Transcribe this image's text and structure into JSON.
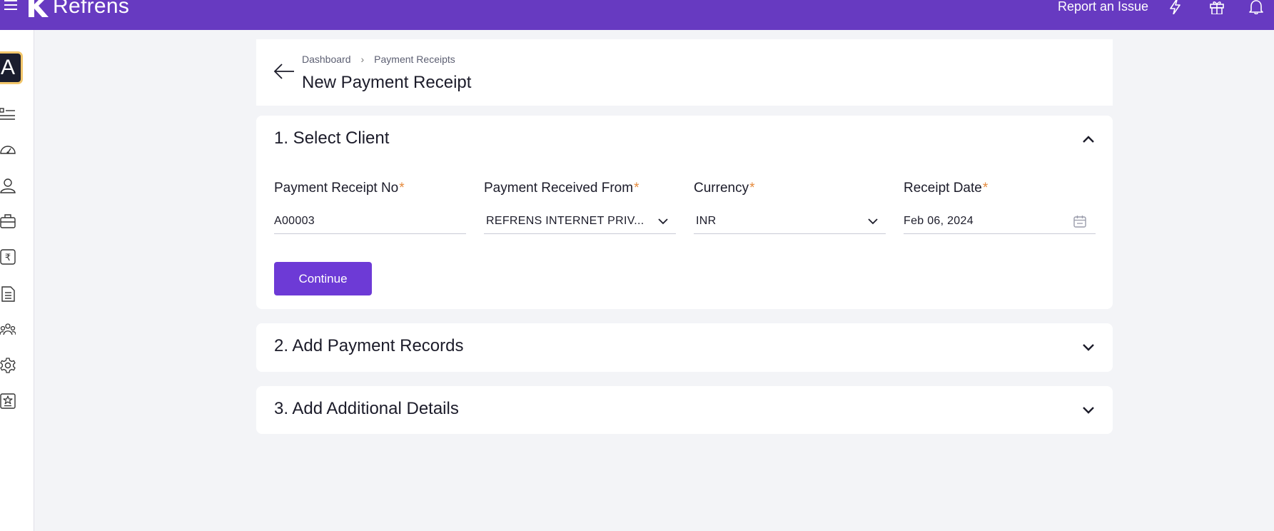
{
  "topbar": {
    "brand": "Refrens",
    "report_issue": "Report an Issue",
    "icons": [
      "menu-icon",
      "lightning-icon",
      "gift-icon",
      "bell-icon"
    ],
    "bg_color": "#673ac1"
  },
  "sidebar": {
    "avatar_letter": "A",
    "items": [
      "list-icon",
      "dashboard-gauge-icon",
      "user-icon",
      "briefcase-icon",
      "rupee-icon",
      "document-icon",
      "team-icon",
      "settings-gear-icon",
      "certificate-badge-icon"
    ]
  },
  "header": {
    "breadcrumb": [
      "Dashboard",
      "Payment Receipts"
    ],
    "title": "New Payment Receipt"
  },
  "sections": [
    {
      "title": "1. Select Client",
      "expanded": true,
      "fields": [
        {
          "label": "Payment Receipt No",
          "required": "*",
          "value": "A00003",
          "type": "text"
        },
        {
          "label": "Payment Received From",
          "required": "*",
          "value": "REFRENS INTERNET PRIV...",
          "type": "select"
        },
        {
          "label": "Currency",
          "required": "*",
          "value": "INR",
          "type": "select"
        },
        {
          "label": "Receipt Date",
          "required": "*",
          "value": "Feb 06, 2024",
          "type": "date"
        }
      ],
      "continue_label": "Continue"
    },
    {
      "title": "2. Add Payment Records",
      "expanded": false
    },
    {
      "title": "3. Add Additional Details",
      "expanded": false
    }
  ],
  "colors": {
    "accent": "#6d3ad6",
    "required": "#e58a3c",
    "page_bg": "#f3f4f7"
  }
}
